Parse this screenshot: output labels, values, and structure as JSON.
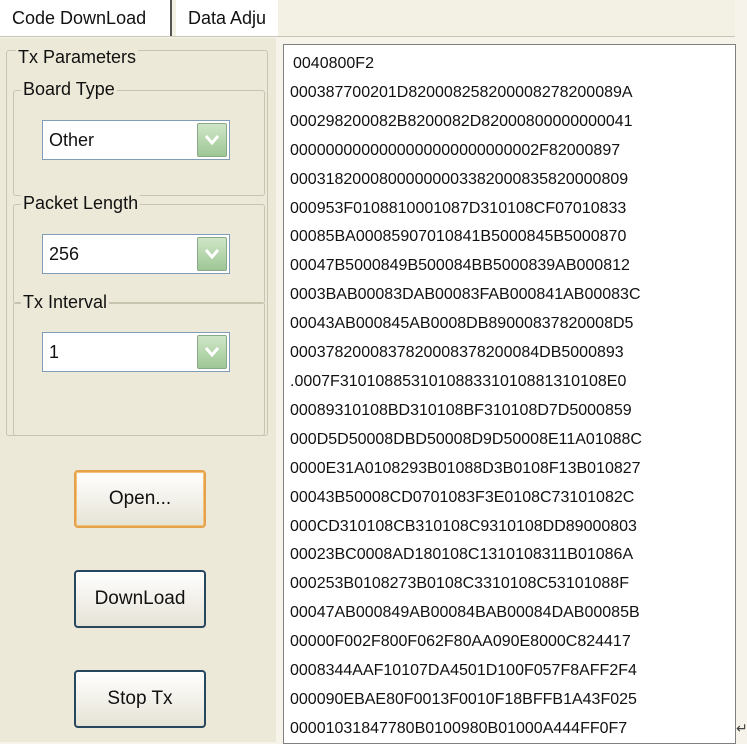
{
  "tabs": [
    {
      "label": "Code DownLoad"
    },
    {
      "label": "Data Adju"
    }
  ],
  "tx_parameters": {
    "title": "Tx Parameters",
    "board_type": {
      "label": "Board Type",
      "value": "Other"
    },
    "packet_length": {
      "label": "Packet Length",
      "value": "256"
    },
    "tx_interval": {
      "label": "Tx Interval",
      "value": "1"
    }
  },
  "buttons": {
    "open": "Open...",
    "download": "DownLoad",
    "stop_tx": "Stop Tx"
  },
  "hex_lines": [
    "0040800F2",
    "000387700201D820008258200008278200089A",
    "000298200082B8200082D82000800000000041",
    "0000000000000000000000000002F82000897",
    "00031820008000000003382000835820000809",
    "000953F010881000108​7D310108CF07010833",
    "00085BA000859070108​41B5000845B5000870",
    "00047B5000849B500084BB5000839AB000812",
    "0003BAB00083DAB00083FAB000841AB00083C",
    "00043AB000845AB0008DB89000837820008D5",
    "0003782000837820008378200084DB5000893",
    ".0007F31010885310108833101088131010​8E0",
    "00089310108BD310108BF310108D7D5000859",
    "000D5D50008DBD50008D9D50008E11A01088C",
    "0000E31A0108293B01088D3B0108F13B010827",
    "00043B50008CD0701083F3E0108C73101082C",
    "000CD310108CB310108C9310108DD89000803",
    "00023BC0008AD180108C1310108311B01086A",
    "000253B0108273B0108C3310108C53101088F",
    "00047AB000849AB00084BAB00084DAB00085B",
    "00000F002F800F062F80AA090E8000C824417",
    "0008344AAF10107DA4501D100F057F8AFF2F4",
    "000090EBAE80F0013F0010F18BFFB1A43F025",
    "0000103184778​0B0100980B01000A444FF0F7"
  ],
  "para_mark": "↵"
}
